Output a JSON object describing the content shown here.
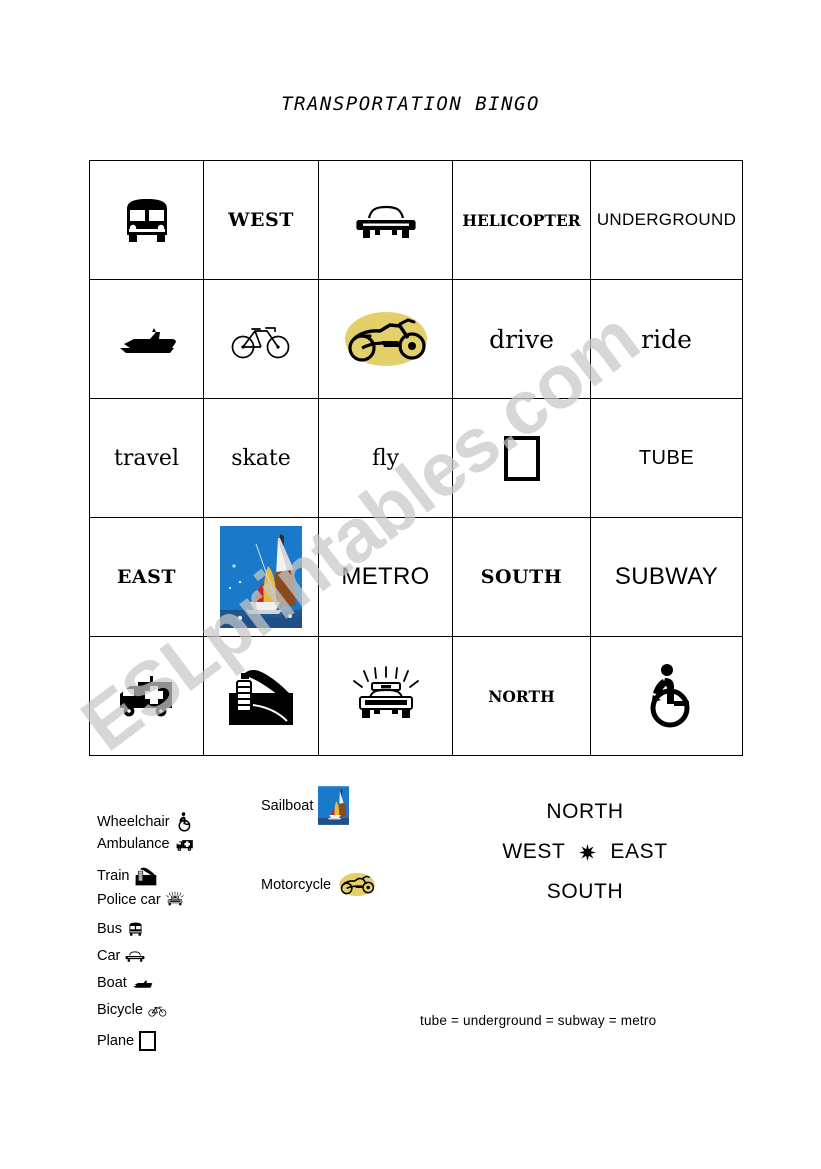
{
  "document": {
    "title": "TRANSPORTATION BINGO",
    "watermark": "ESLprintables.com"
  },
  "grid": {
    "rows": [
      [
        {
          "kind": "icon",
          "icon": "bus-icon",
          "label": "Bus"
        },
        {
          "kind": "text",
          "text": "WEST",
          "style": "w-serif-bold"
        },
        {
          "kind": "icon",
          "icon": "car-icon",
          "label": "Car"
        },
        {
          "kind": "text",
          "text": "HELICOPTER",
          "style": "w-serif-bold-sm"
        },
        {
          "kind": "text",
          "text": "UNDERGROUND",
          "style": "w-sans-thin"
        }
      ],
      [
        {
          "kind": "icon",
          "icon": "boat-icon",
          "label": "Boat"
        },
        {
          "kind": "icon",
          "icon": "bicycle-icon",
          "label": "Bicycle"
        },
        {
          "kind": "icon",
          "icon": "motorcycle-icon",
          "label": "Motorcycle"
        },
        {
          "kind": "text",
          "text": "drive",
          "style": "w-serif-low"
        },
        {
          "kind": "text",
          "text": "ride",
          "style": "w-serif-low"
        }
      ],
      [
        {
          "kind": "text",
          "text": "travel",
          "style": "w-serif-low-sm"
        },
        {
          "kind": "text",
          "text": "skate",
          "style": "w-serif-low-sm"
        },
        {
          "kind": "text",
          "text": "fly",
          "style": "w-serif-low-sm"
        },
        {
          "kind": "icon",
          "icon": "plane-missing-glyph-icon",
          "label": "Plane"
        },
        {
          "kind": "text",
          "text": "TUBE",
          "style": "w-sans-tube"
        }
      ],
      [
        {
          "kind": "text",
          "text": "EAST",
          "style": "w-serif-bold"
        },
        {
          "kind": "icon",
          "icon": "sailboat-photo-icon",
          "label": "Sailboat"
        },
        {
          "kind": "text",
          "text": "METRO",
          "style": "w-sans-mid"
        },
        {
          "kind": "text",
          "text": "SOUTH",
          "style": "w-serif-bold"
        },
        {
          "kind": "text",
          "text": "SUBWAY",
          "style": "w-sans-mid"
        }
      ],
      [
        {
          "kind": "icon",
          "icon": "ambulance-icon",
          "label": "Ambulance"
        },
        {
          "kind": "icon",
          "icon": "train-icon",
          "label": "Train"
        },
        {
          "kind": "icon",
          "icon": "police-car-icon",
          "label": "Police car"
        },
        {
          "kind": "text",
          "text": "NORTH",
          "style": "w-serif-bold-sm"
        },
        {
          "kind": "icon",
          "icon": "wheelchair-icon",
          "label": "Wheelchair"
        }
      ]
    ]
  },
  "legend": {
    "left": [
      {
        "label": "Wheelchair",
        "icon": "wheelchair-icon"
      },
      {
        "label": "Ambulance",
        "icon": "ambulance-icon"
      },
      {
        "label": "Train",
        "icon": "train-icon"
      },
      {
        "label": "Police car",
        "icon": "police-car-icon"
      },
      {
        "label": "Bus",
        "icon": "bus-icon"
      },
      {
        "label": "Car",
        "icon": "car-icon"
      },
      {
        "label": "Boat",
        "icon": "boat-icon"
      },
      {
        "label": "Bicycle",
        "icon": "bicycle-icon"
      },
      {
        "label": "Plane",
        "icon": "plane-missing-glyph-icon"
      }
    ],
    "mid": [
      {
        "label": "Sailboat",
        "icon": "sailboat-photo-icon"
      },
      {
        "label": "Motorcycle",
        "icon": "motorcycle-icon"
      }
    ]
  },
  "compass": {
    "north": "NORTH",
    "west": "WEST",
    "east": "EAST",
    "south": "SOUTH",
    "star": "compass-star-icon"
  },
  "note": "tube = underground = subway = metro",
  "colors": {
    "motorcycle_blob": "#e3d06a",
    "sailboat_sky": "#1b79c9",
    "sailboat_sail_yellow": "#e8b93c",
    "sailboat_sail_red": "#c0282a",
    "sailboat_sail_brown": "#8a4a20",
    "watermark_gray": "#c8c8c8",
    "ink": "#000000"
  }
}
